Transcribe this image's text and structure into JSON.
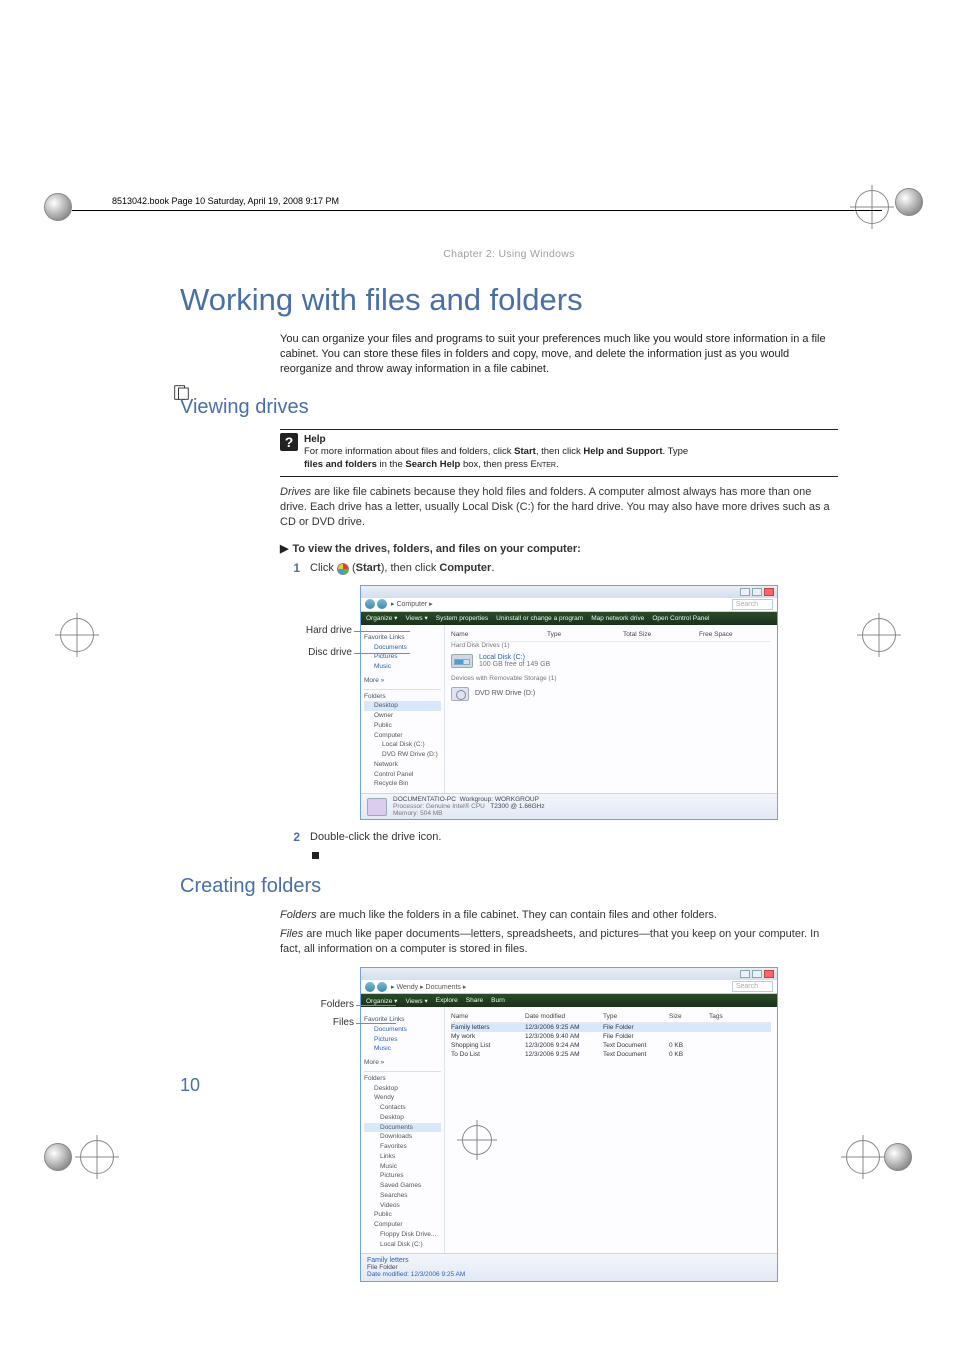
{
  "header": {
    "file_stamp": "8513042.book  Page 10  Saturday, April 19, 2008  9:17 PM"
  },
  "chapter_label": "Chapter 2: Using Windows",
  "title": "Working with files and folders",
  "intro": "You can organize your files and programs to suit your preferences much like you would store information in a file cabinet. You can store these files in folders and copy, move, and delete the information just as you would reorganize and throw away information in a file cabinet.",
  "section1": {
    "heading": "Viewing drives",
    "help": {
      "title": "Help",
      "line1_a": "For more information about files and folders, click ",
      "line1_b": "Start",
      "line1_c": ", then click ",
      "line1_d": "Help and Support",
      "line1_e": ". Type ",
      "line2_a": "files and folders",
      "line2_b": " in the ",
      "line2_c": "Search Help",
      "line2_d": " box, then press ",
      "line2_e": "Enter",
      "line2_f": "."
    },
    "drives_para_a": "Drives",
    "drives_para_b": " are like file cabinets because they hold files and folders. A computer almost always has more than one drive. Each drive has a letter, usually Local Disk (C:) for the hard drive. You may also have more drives such as a CD or DVD drive.",
    "proc_head": "To view the drives, folders, and files on your computer:",
    "step1_a": "Click ",
    "step1_b": " (",
    "step1_c": "Start",
    "step1_d": "), then click ",
    "step1_e": "Computer",
    "step1_f": ".",
    "step2": "Double-click the drive icon.",
    "callouts": {
      "hard_drive": "Hard drive",
      "disc_drive": "Disc drive"
    },
    "shot": {
      "breadcrumb": "▸ Computer ▸",
      "search_placeholder": "Search",
      "toolbar": [
        "Organize ▾",
        "Views ▾",
        "System properties",
        "Uninstall or change a program",
        "Map network drive",
        "Open Control Panel"
      ],
      "favorites_hdr": "Favorite Links",
      "favorites": [
        "Documents",
        "Pictures",
        "Music"
      ],
      "more": "More »",
      "folders_hdr": "Folders",
      "tree": [
        "Desktop",
        "Owner",
        "Public",
        "Computer",
        "Local Disk (C:)",
        "DVD RW Drive (D:)",
        "Network",
        "Control Panel",
        "Recycle Bin"
      ],
      "columns": [
        "Name",
        "Type",
        "Total Size",
        "Free Space"
      ],
      "group1": "Hard Disk Drives (1)",
      "drive1": "Local Disk (C:)",
      "drive1_sub": "100 GB free of 149 GB",
      "group2": "Devices with Removable Storage (1)",
      "drive2": "DVD RW Drive (D:)",
      "status_name": "DOCUMENTATIO-PC",
      "status_wg": "Workgroup: WORKGROUP",
      "status_proc": "Processor: Genuine Intel® CPU",
      "status_proc2": "T2300 @ 1.66GHz",
      "status_mem": "Memory: 504 MB"
    }
  },
  "section2": {
    "heading": "Creating folders",
    "folders_para_a": "Folders",
    "folders_para_b": " are much like the folders in a file cabinet. They can contain files and other folders.",
    "files_para_a": "Files",
    "files_para_b": " are much like paper documents—letters, spreadsheets, and pictures—that you keep on your computer. In fact, all information on a computer is stored in files.",
    "callouts": {
      "folders": "Folders",
      "files": "Files"
    },
    "shot": {
      "breadcrumb": "▸ Wendy ▸ Documents ▸",
      "search_placeholder": "Search",
      "toolbar": [
        "Organize ▾",
        "Views ▾",
        "Explore",
        "Share",
        "Burn"
      ],
      "columns": [
        "Name",
        "Date modified",
        "Type",
        "Size",
        "Tags"
      ],
      "rows": [
        {
          "name": "Family letters",
          "date": "12/3/2006 9:25 AM",
          "type": "File Folder",
          "size": "",
          "sel": true
        },
        {
          "name": "My work",
          "date": "12/3/2006 9:40 AM",
          "type": "File Folder",
          "size": ""
        },
        {
          "name": "Shopping List",
          "date": "12/3/2006 9:24 AM",
          "type": "Text Document",
          "size": "0 KB"
        },
        {
          "name": "To Do List",
          "date": "12/3/2006 9:25 AM",
          "type": "Text Document",
          "size": "0 KB"
        }
      ],
      "favorites_hdr": "Favorite Links",
      "favorites": [
        "Documents",
        "Pictures",
        "Music"
      ],
      "more": "More »",
      "folders_hdr": "Folders",
      "tree": [
        "Desktop",
        "Wendy",
        "Contacts",
        "Desktop",
        "Documents",
        "Downloads",
        "Favorites",
        "Links",
        "Music",
        "Pictures",
        "Saved Games",
        "Searches",
        "Videos",
        "Public",
        "Computer",
        "Floppy Disk Drive...",
        "Local Disk (C:)"
      ],
      "sel_name": "Family letters",
      "sel_type": "File Folder",
      "sel_date": "Date modified: 12/3/2006 9:25 AM"
    }
  },
  "page_number": "10"
}
